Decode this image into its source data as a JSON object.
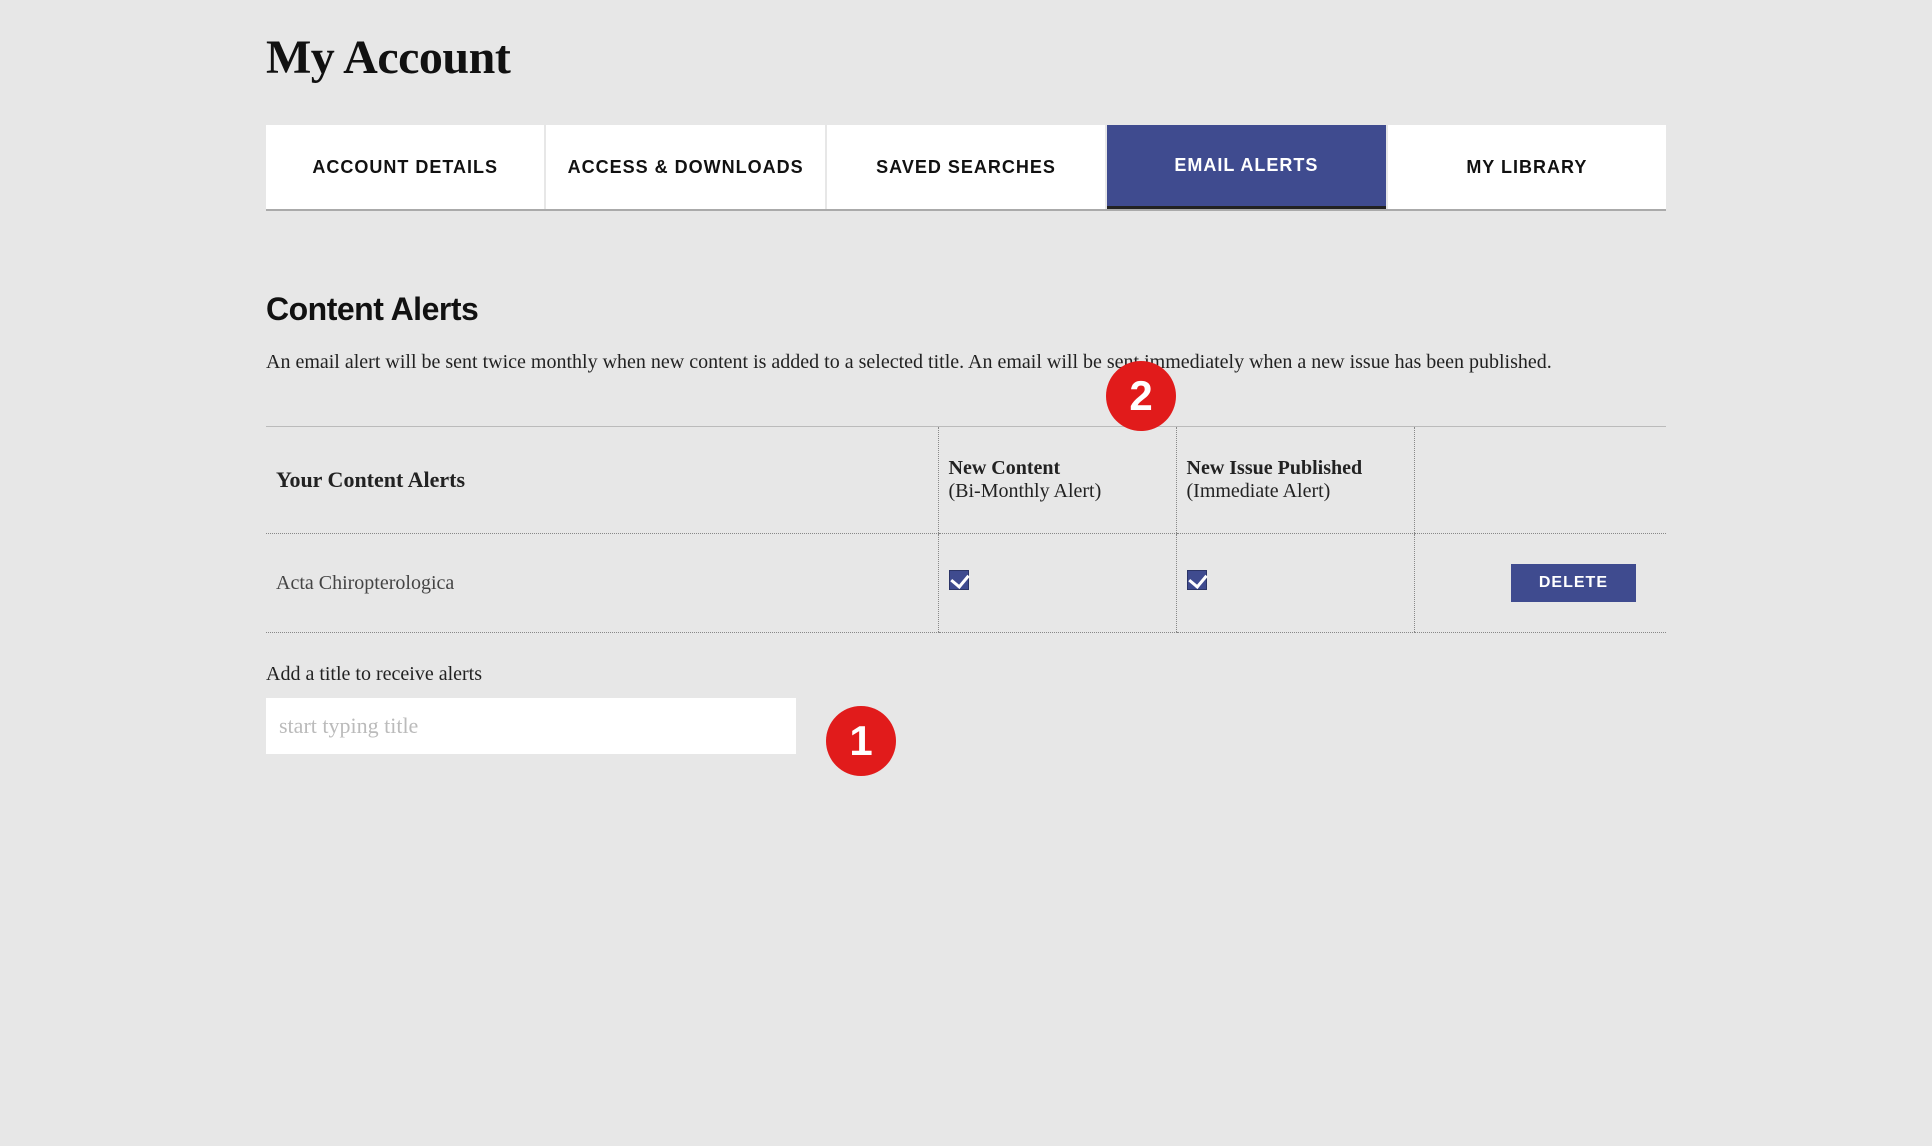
{
  "page": {
    "title": "My Account"
  },
  "tabs": [
    {
      "label": "ACCOUNT DETAILS",
      "active": false
    },
    {
      "label": "ACCESS & DOWNLOADS",
      "active": false
    },
    {
      "label": "SAVED SEARCHES",
      "active": false
    },
    {
      "label": "EMAIL ALERTS",
      "active": true
    },
    {
      "label": "MY LIBRARY",
      "active": false
    }
  ],
  "section": {
    "title": "Content Alerts",
    "description": "An email alert will be sent twice monthly when new content is added to a selected title. An email will be sent immediately when a new issue has been published."
  },
  "table": {
    "header": {
      "yours": "Your Content Alerts",
      "new_content_bold": "New Content",
      "new_content_sub": "(Bi-Monthly Alert)",
      "new_issue_bold": "New Issue Published",
      "new_issue_sub": "(Immediate Alert)"
    },
    "rows": [
      {
        "title": "Acta Chiropterologica",
        "new_content": true,
        "new_issue": true,
        "delete_label": "DELETE"
      }
    ]
  },
  "add": {
    "label": "Add a title to receive alerts",
    "placeholder": "start typing title"
  },
  "badges": {
    "one": "1",
    "two": "2"
  }
}
